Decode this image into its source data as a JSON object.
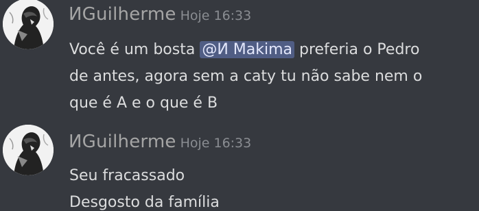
{
  "messages": [
    {
      "username": "ИGuilherme",
      "timestamp": "Hoje 16:33",
      "lines": [
        {
          "before": "Você é um bosta ",
          "mention": "@И Makima",
          "after": " preferia o Pedro"
        },
        {
          "text": "de antes, agora sem a caty tu não sabe nem o"
        },
        {
          "text": "que é A e o que é B"
        }
      ]
    },
    {
      "username": "ИGuilherme",
      "timestamp": "Hoje 16:33",
      "lines": [
        {
          "text": "Seu fracassado"
        },
        {
          "text": "Desgosto da família"
        }
      ]
    }
  ],
  "colors": {
    "background": "#36393f",
    "username": "#a5a5a5",
    "timestamp": "#8a8d92",
    "text": "#dcddde",
    "mention_bg": "#5865a7"
  },
  "icons": {
    "avatar": "manga-avatar-icon"
  }
}
